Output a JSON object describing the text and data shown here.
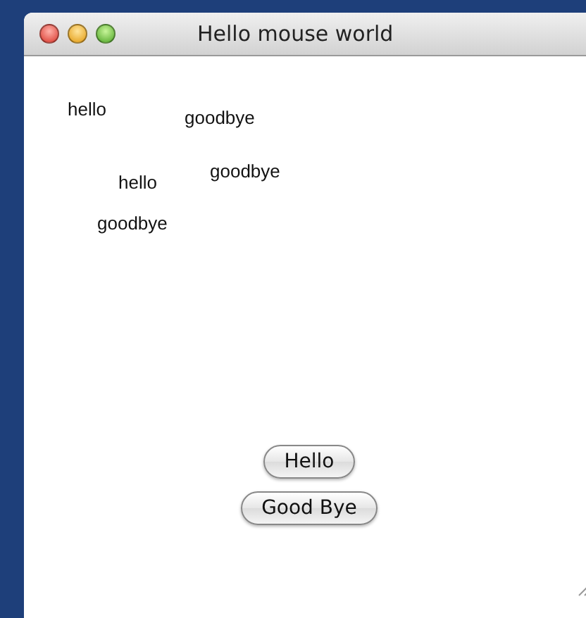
{
  "window": {
    "title": "Hello mouse world"
  },
  "canvas_words": [
    "hello",
    "goodbye",
    "goodbye",
    "hello",
    "goodbye"
  ],
  "buttons": [
    "Hello",
    "Good Bye"
  ]
}
